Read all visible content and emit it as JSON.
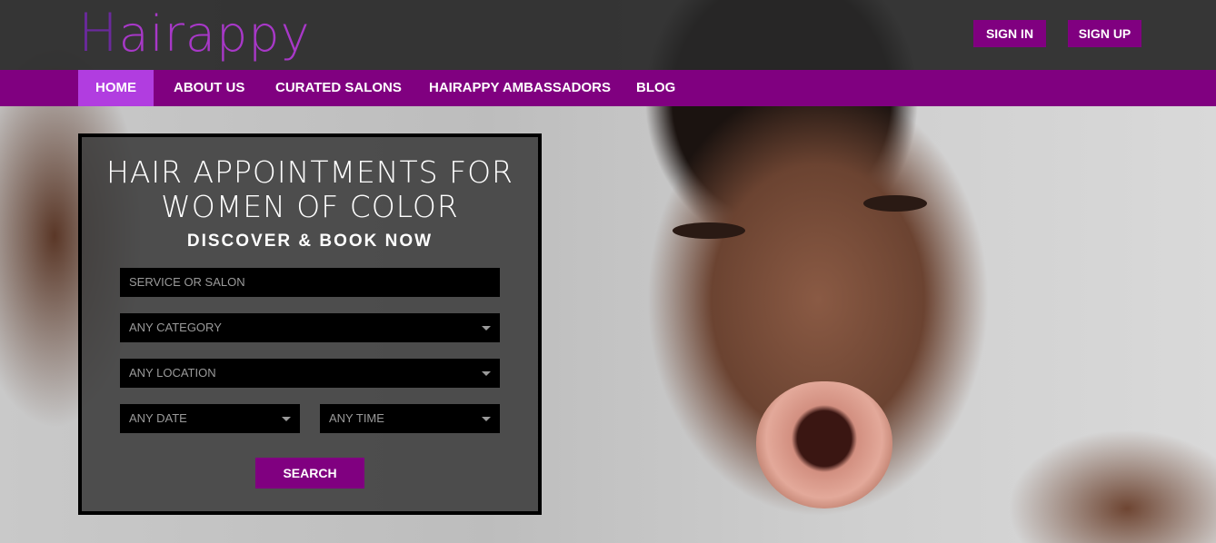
{
  "brand": {
    "logo_first": "H",
    "logo_rest": "airappy",
    "accent_color": "#800080",
    "accent_light": "#b13de0"
  },
  "header": {
    "sign_in": "SIGN IN",
    "sign_up": "SIGN UP"
  },
  "nav": {
    "items": [
      {
        "label": "HOME",
        "active": true
      },
      {
        "label": "ABOUT US",
        "active": false
      },
      {
        "label": "CURATED SALONS",
        "active": false
      },
      {
        "label": "HAIRAPPY AMBASSADORS",
        "active": false
      },
      {
        "label": "BLOG",
        "active": false
      }
    ]
  },
  "search_panel": {
    "title_line1": "HAIR APPOINTMENTS FOR",
    "title_line2": "WOMEN OF COLOR",
    "subtitle": "DISCOVER & BOOK NOW",
    "service_placeholder": "SERVICE OR SALON",
    "category_value": "ANY CATEGORY",
    "location_value": "ANY LOCATION",
    "date_value": "ANY DATE",
    "time_value": "ANY TIME",
    "search_label": "SEARCH"
  },
  "icons": {
    "dropdown": "chevron-down-icon"
  }
}
